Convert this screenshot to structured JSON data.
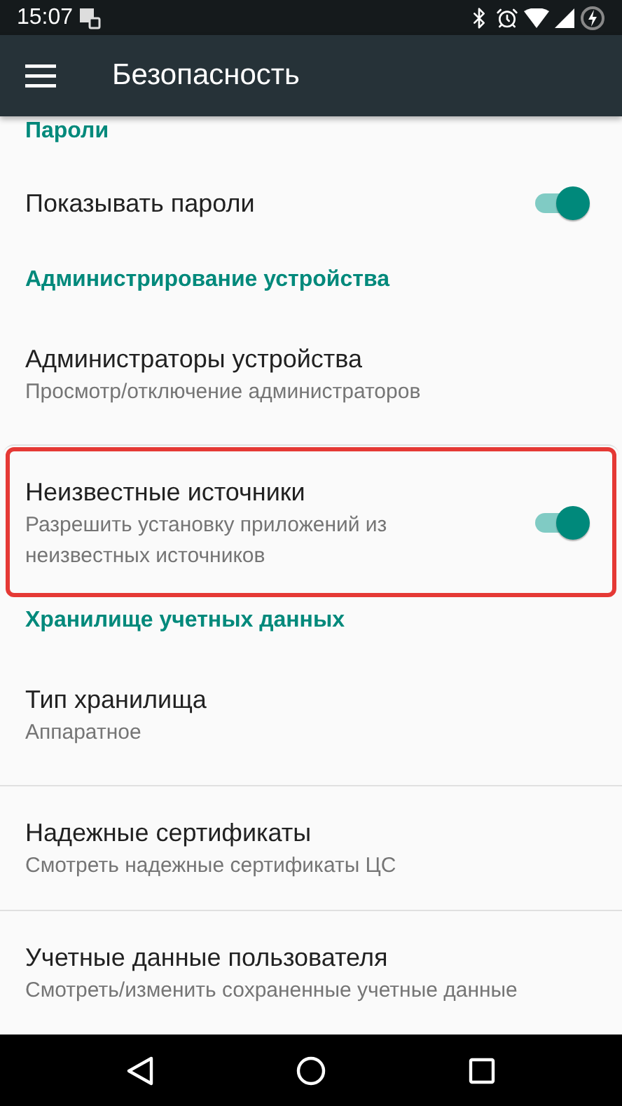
{
  "status_bar": {
    "time": "15:07"
  },
  "toolbar": {
    "title": "Безопасность"
  },
  "sections": [
    {
      "header": "Пароли",
      "items": [
        {
          "title": "Показывать пароли",
          "kind": "switch",
          "on": true,
          "highlighted": false
        }
      ]
    },
    {
      "header": "Администрирование устройства",
      "items": [
        {
          "title": "Администраторы устройства",
          "summary": "Просмотр/отключение администраторов",
          "kind": "plain",
          "highlighted": false
        },
        {
          "title": "Неизвестные источники",
          "summary": "Разрешить установку приложений из неизвестных источников",
          "kind": "switch",
          "on": true,
          "highlighted": true
        }
      ]
    },
    {
      "header": "Хранилище учетных данных",
      "items": [
        {
          "title": "Тип хранилища",
          "summary": "Аппаратное",
          "kind": "plain",
          "highlighted": false
        },
        {
          "title": "Надежные сертификаты",
          "summary": "Смотреть надежные сертификаты ЦС",
          "kind": "plain",
          "highlighted": false
        },
        {
          "title": "Учетные данные пользователя",
          "summary": "Смотреть/изменить сохраненные учетные данные",
          "kind": "plain",
          "highlighted": false
        }
      ]
    }
  ]
}
